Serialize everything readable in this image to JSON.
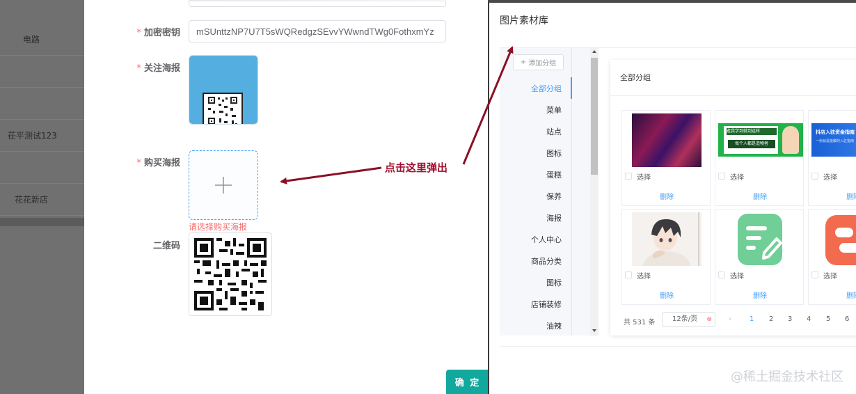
{
  "sidebar": {
    "items": [
      {
        "label": "电路"
      },
      {
        "label": ""
      },
      {
        "label": ""
      },
      {
        "label": "茌平测试123"
      },
      {
        "label": ""
      },
      {
        "label": "花花新店"
      }
    ]
  },
  "form": {
    "fields": {
      "secret_key": {
        "label": "加密密钥",
        "value": "mSUnttzNP7U7T5sWQRedgzSEvvYWwndTWg0FothxmYz",
        "required": true
      },
      "follow_poster": {
        "label": "关注海报",
        "required": true
      },
      "buy_poster": {
        "label": "购买海报",
        "required": true,
        "error": "请选择购买海报"
      },
      "qrcode": {
        "label": "二维码",
        "required": false
      }
    },
    "required_mark": "*",
    "confirm_label": "确 定"
  },
  "annotation": {
    "text": "点击这里弹出"
  },
  "library": {
    "title": "图片素材库",
    "add_group_label": "添加分组",
    "groups": [
      "全部分组",
      "菜单",
      "站点",
      "图标",
      "蛋糕",
      "保养",
      "海报",
      "个人中心",
      "商品分类",
      "图标",
      "店铺装修",
      "油辣"
    ],
    "active_group_index": 0,
    "panel_title": "全部分组",
    "select_label": "选择",
    "delete_label": "删除",
    "images": [
      {
        "name": "purple-abstract-image"
      },
      {
        "name": "banner-promo-image",
        "text1": "逛我学到就到这样",
        "text2": "每个人都是造物者"
      },
      {
        "name": "blue-banner-image",
        "text1": "抖店入驻资金指南",
        "text2": "一份就是能聚的入驻指南"
      },
      {
        "name": "anime-character-image"
      },
      {
        "name": "green-document-icon-image"
      },
      {
        "name": "orange-app-icon-image"
      }
    ],
    "pagination": {
      "total_text": "共 531 条",
      "page_size_text": "12条/页",
      "prev_symbol": "‹",
      "pages": [
        "1",
        "2",
        "3",
        "4",
        "5",
        "6"
      ],
      "current_page": "1"
    }
  },
  "watermark": "@稀土掘金技术社区",
  "colors": {
    "accent": "#409eff",
    "confirm": "#13a89e",
    "error": "#f56c6c",
    "annotation": "#a0102e"
  }
}
